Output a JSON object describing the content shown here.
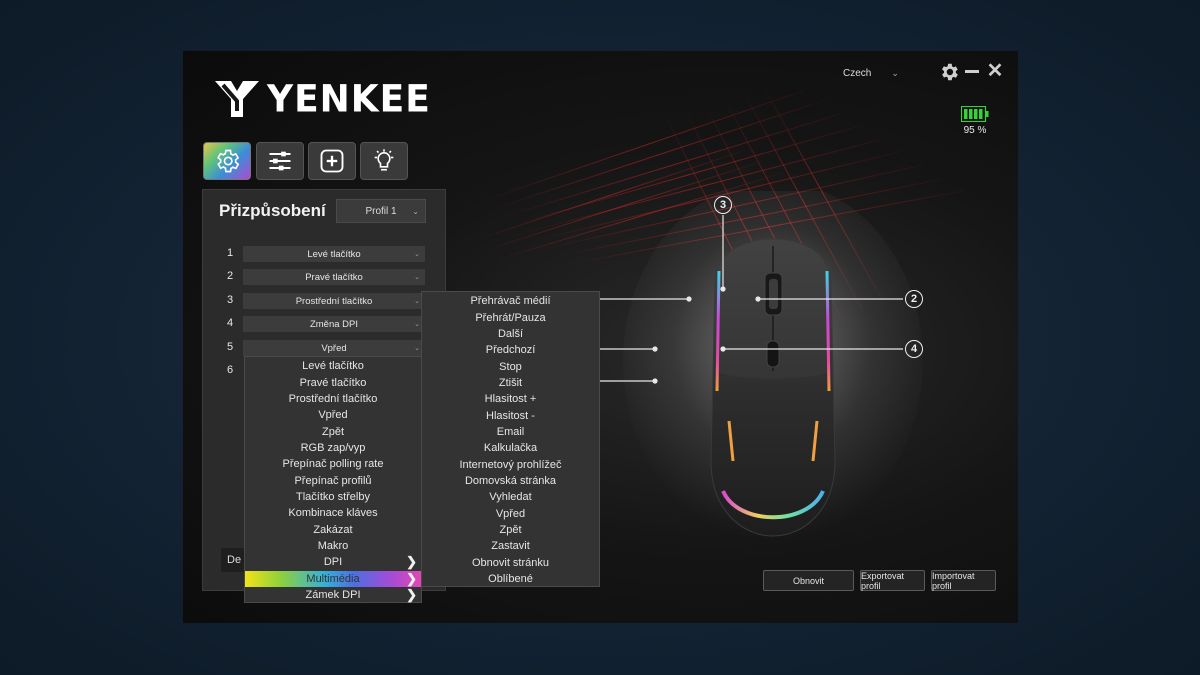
{
  "brand": {
    "logo_text": "YENKEE"
  },
  "window": {
    "language": "Czech",
    "battery_percent_text": "95 %",
    "battery_level": 0.95
  },
  "tabs": [
    {
      "name": "settings",
      "icon": "gear-icon",
      "active": true
    },
    {
      "name": "adjust",
      "icon": "sliders-icon",
      "active": false
    },
    {
      "name": "macro",
      "icon": "plus-square-icon",
      "active": false
    },
    {
      "name": "lighting",
      "icon": "lightbulb-icon",
      "active": false
    }
  ],
  "panel": {
    "title": "Přizpůsobení",
    "profile": "Profil 1",
    "buttons": [
      {
        "num": "1",
        "value": "Levé tlačítko"
      },
      {
        "num": "2",
        "value": "Pravé tlačítko"
      },
      {
        "num": "3",
        "value": "Prostřední tlačítko"
      },
      {
        "num": "4",
        "value": "Změna DPI"
      },
      {
        "num": "5",
        "value": "Vpřed"
      },
      {
        "num": "6",
        "value": ""
      }
    ],
    "default_button": "De"
  },
  "function_menu": {
    "items": [
      {
        "label": "Levé tlačítko",
        "submenu": false
      },
      {
        "label": "Pravé tlačítko",
        "submenu": false
      },
      {
        "label": "Prostřední tlačítko",
        "submenu": false
      },
      {
        "label": "Vpřed",
        "submenu": false
      },
      {
        "label": "Zpět",
        "submenu": false
      },
      {
        "label": "RGB zap/vyp",
        "submenu": false
      },
      {
        "label": "Přepínač polling rate",
        "submenu": false
      },
      {
        "label": "Přepínač profilů",
        "submenu": false
      },
      {
        "label": "Tlačítko střelby",
        "submenu": false
      },
      {
        "label": "Kombinace kláves",
        "submenu": false
      },
      {
        "label": "Zakázat",
        "submenu": false
      },
      {
        "label": "Makro",
        "submenu": false
      },
      {
        "label": "DPI",
        "submenu": true
      },
      {
        "label": "Multimédia",
        "submenu": true,
        "highlighted": true
      },
      {
        "label": "Zámek DPI",
        "submenu": true
      }
    ]
  },
  "multimedia_menu": {
    "items": [
      "Přehrávač médií",
      "Přehrát/Pauza",
      "Další",
      "Předchozí",
      "Stop",
      "Ztišit",
      "Hlasitost +",
      "Hlasitost -",
      "Email",
      "Kalkulačka",
      "Internetový prohlížeč",
      "Domovská stránka",
      "Vyhledat",
      "Vpřed",
      "Zpět",
      "Zastavit",
      "Obnovit stránku",
      "Oblíbené"
    ]
  },
  "callouts": [
    "3",
    "2",
    "4"
  ],
  "bottom_buttons": {
    "reset": "Obnovit",
    "export": "Exportovat profil",
    "import": "Importovat profil"
  },
  "colors": {
    "accent_gradient": [
      "#f2e21a",
      "#36b0d8",
      "#a24cd8",
      "#e048b4"
    ],
    "battery": "#38d13a",
    "background": "#0b0b0b"
  }
}
